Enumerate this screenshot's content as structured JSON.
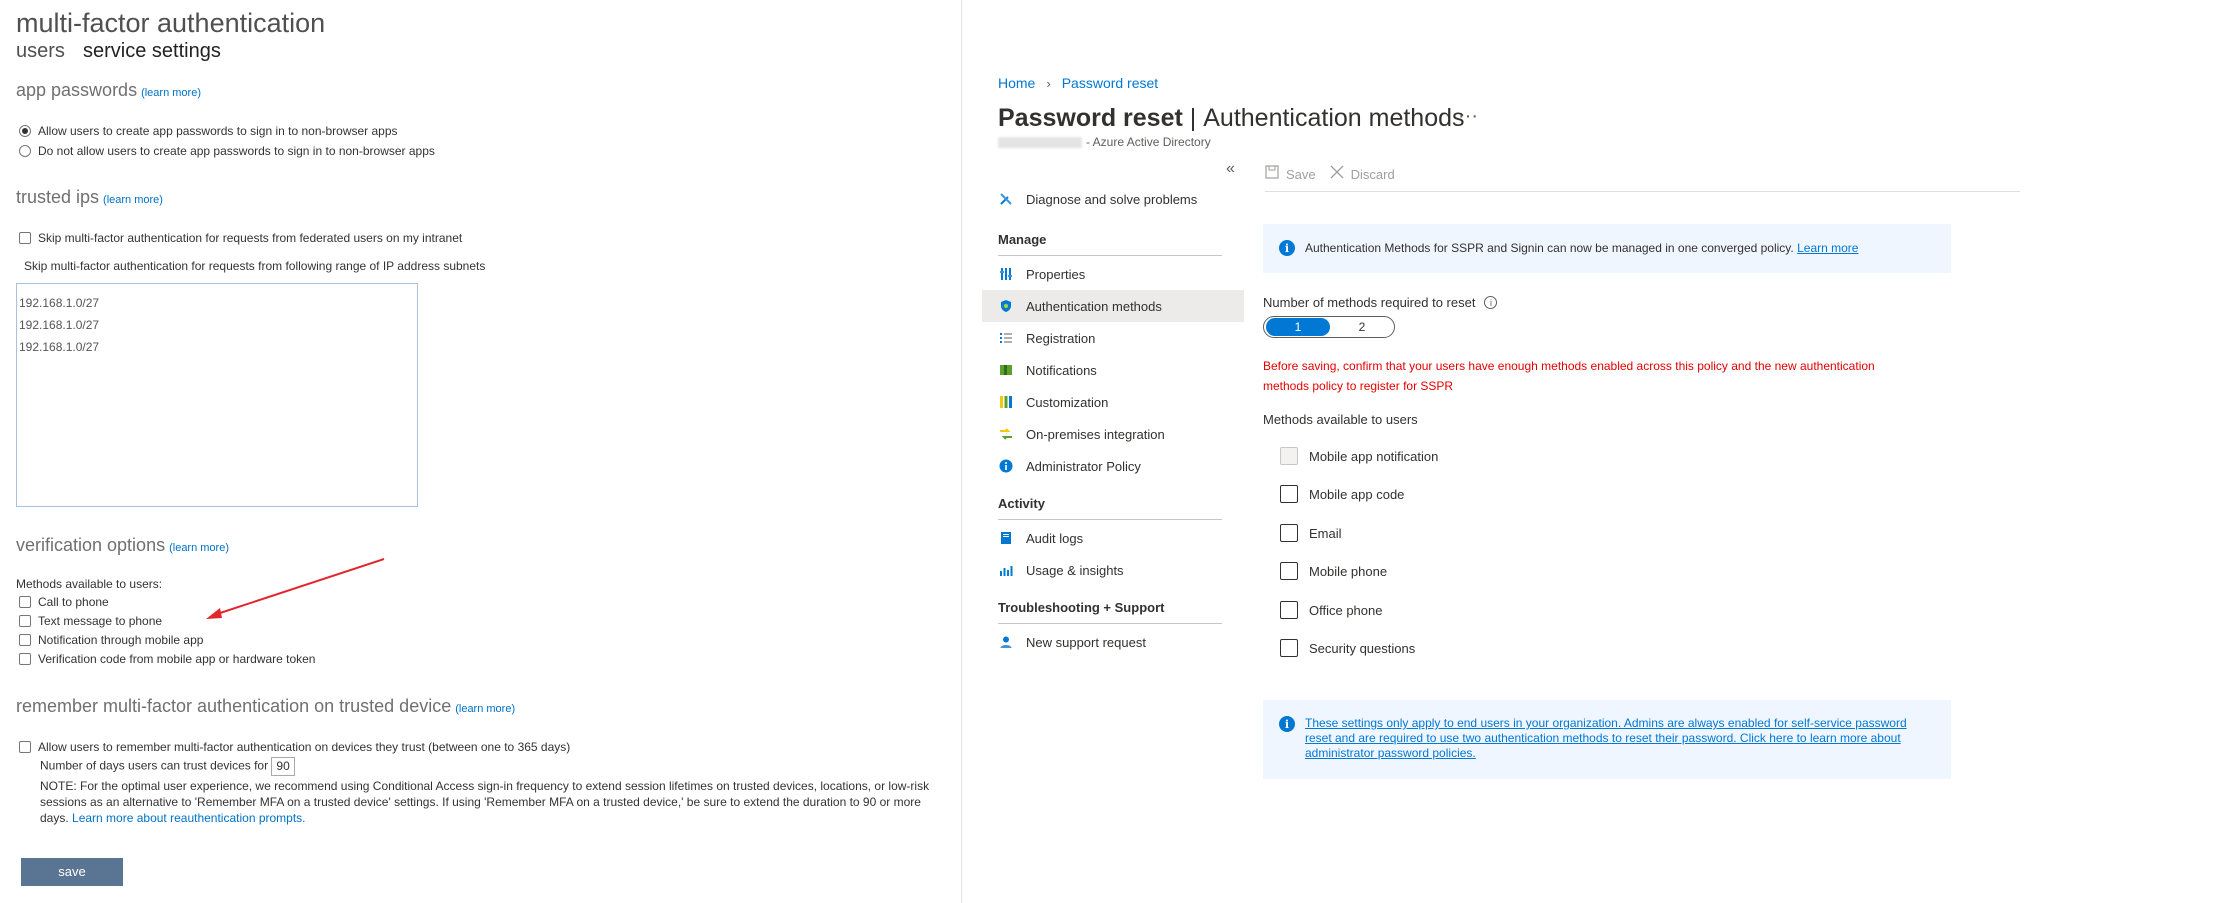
{
  "mfa": {
    "title": "multi-factor authentication",
    "tabs": [
      "users",
      "service settings"
    ],
    "app_passwords": {
      "title": "app passwords",
      "learn_more": "(learn more)",
      "options": [
        "Allow users to create app passwords to sign in to non-browser apps",
        "Do not allow users to create app passwords to sign in to non-browser apps"
      ],
      "selected_index": 0
    },
    "trusted_ips": {
      "title": "trusted ips",
      "learn_more": "(learn more)",
      "skip_federated": "Skip multi-factor authentication for requests from federated users on my intranet",
      "skip_range": "Skip multi-factor authentication for requests from following range of IP address subnets",
      "ips": [
        "192.168.1.0/27",
        "192.168.1.0/27",
        "192.168.1.0/27"
      ]
    },
    "verification": {
      "title": "verification options",
      "learn_more": "(learn more)",
      "methods_label": "Methods available to users:",
      "methods": [
        "Call to phone",
        "Text message to phone",
        "Notification through mobile app",
        "Verification code from mobile app or hardware token"
      ]
    },
    "remember": {
      "title": "remember multi-factor authentication on trusted device",
      "learn_more": "(learn more)",
      "allow_label": "Allow users to remember multi-factor authentication on devices they trust (between one to 365 days)",
      "days_label": "Number of days users can trust devices for",
      "days_value": "90",
      "note": "NOTE: For the optimal user experience, we recommend using Conditional Access sign-in frequency to extend session lifetimes on trusted devices, locations, or low-risk sessions as an alternative to 'Remember MFA on a trusted device' settings. If using 'Remember MFA on a trusted device,' be sure to extend the duration to 90 or more days.",
      "note_link": "Learn more about reauthentication prompts."
    },
    "save_label": "save",
    "arrow_color": "#e3262e"
  },
  "azure": {
    "breadcrumb": [
      "Home",
      "Password reset"
    ],
    "title_main": "Password reset",
    "title_sep": "|",
    "title_sub": "Authentication methods",
    "more": "···",
    "subtitle": "- Azure Active Directory",
    "collapse": "«",
    "nav": {
      "top_item": {
        "label": "Diagnose and solve problems",
        "icon": "wrench-icon"
      },
      "groups": [
        {
          "label": "Manage",
          "items": [
            {
              "label": "Properties",
              "icon": "properties-icon",
              "selected": false
            },
            {
              "label": "Authentication methods",
              "icon": "shield-icon",
              "selected": true
            },
            {
              "label": "Registration",
              "icon": "list-icon",
              "selected": false
            },
            {
              "label": "Notifications",
              "icon": "notification-icon",
              "selected": false
            },
            {
              "label": "Customization",
              "icon": "customization-icon",
              "selected": false
            },
            {
              "label": "On-premises integration",
              "icon": "integration-icon",
              "selected": false
            },
            {
              "label": "Administrator Policy",
              "icon": "info-icon",
              "selected": false
            }
          ]
        },
        {
          "label": "Activity",
          "items": [
            {
              "label": "Audit logs",
              "icon": "book-icon",
              "selected": false
            },
            {
              "label": "Usage & insights",
              "icon": "chart-icon",
              "selected": false
            }
          ]
        },
        {
          "label": "Troubleshooting + Support",
          "items": [
            {
              "label": "New support request",
              "icon": "person-icon",
              "selected": false
            }
          ]
        }
      ]
    },
    "toolbar": {
      "save": "Save",
      "discard": "Discard"
    },
    "info_banner": {
      "text": "Authentication Methods for SSPR and Signin can now be managed in one converged policy.",
      "link": "Learn more"
    },
    "required_label": "Number of methods required to reset",
    "toggle": {
      "options": [
        "1",
        "2"
      ],
      "selected": "1"
    },
    "warning": "Before saving, confirm that your users have enough methods enabled across this policy and the new authentication methods policy to register for SSPR",
    "methods_label": "Methods available to users",
    "methods": [
      {
        "label": "Mobile app notification",
        "disabled": true
      },
      {
        "label": "Mobile app code",
        "disabled": false
      },
      {
        "label": "Email",
        "disabled": false
      },
      {
        "label": "Mobile phone",
        "disabled": false
      },
      {
        "label": "Office phone",
        "disabled": false
      },
      {
        "label": "Security questions",
        "disabled": false
      }
    ],
    "bottom_info": "These settings only apply to end users in your organization. Admins are always enabled for self-service password reset and are required to use two authentication methods to reset their password. Click here to learn more about administrator password policies.",
    "accent_color": "#0078d4",
    "warning_color": "#e50000"
  }
}
